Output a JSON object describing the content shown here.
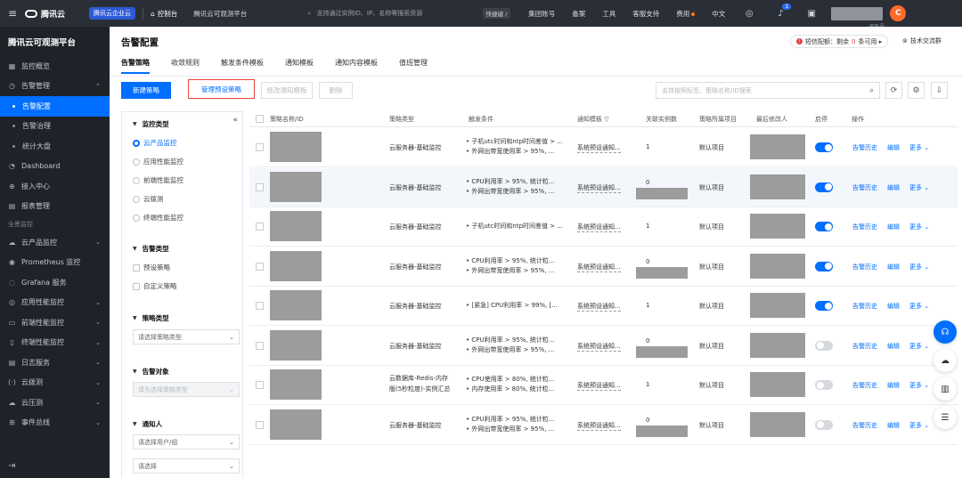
{
  "topbar": {
    "brand": "腾讯云",
    "badge": "腾讯云企业云",
    "console": "控制台",
    "platform_name": "腾讯云可观测平台",
    "search_placeholder": "支持通过实例ID、IP、名称等搜索资源",
    "shortcut": "快捷键 /",
    "links": [
      "集团账号",
      "备案",
      "工具",
      "客服支持",
      "费用",
      "中文"
    ],
    "notification_count": "1",
    "user_sub": "子账号",
    "avatar_letter": "C"
  },
  "sidebar": {
    "title": "腾讯云可观测平台",
    "items": [
      {
        "label": "监控概览",
        "icon": "dashboard-icon",
        "type": "top"
      },
      {
        "label": "告警管理",
        "icon": "alarm-icon",
        "type": "top",
        "chevron": "⌃"
      },
      {
        "label": "告警配置",
        "type": "sub",
        "active": true
      },
      {
        "label": "告警治理",
        "type": "sub"
      },
      {
        "label": "统计大盘",
        "type": "sub"
      },
      {
        "label": "Dashboard",
        "icon": "clock-icon",
        "type": "top"
      },
      {
        "label": "接入中心",
        "icon": "plug-icon",
        "type": "top"
      },
      {
        "label": "报表管理",
        "icon": "report-icon",
        "type": "top"
      }
    ],
    "group_label": "全景监控",
    "items2": [
      {
        "label": "云产品监控",
        "icon": "cloud-icon",
        "chevron": "⌄"
      },
      {
        "label": "Prometheus 监控",
        "icon": "prometheus-icon"
      },
      {
        "label": "Grafana 服务",
        "icon": "grafana-icon"
      },
      {
        "label": "应用性能监控",
        "icon": "apm-icon",
        "chevron": "⌄"
      },
      {
        "label": "前端性能监控",
        "icon": "frontend-icon",
        "chevron": "⌄"
      },
      {
        "label": "终端性能监控",
        "icon": "terminal-icon",
        "chevron": "⌄"
      },
      {
        "label": "日志服务",
        "icon": "log-icon",
        "chevron": "⌄"
      },
      {
        "label": "云拨测",
        "icon": "probe-icon",
        "chevron": "⌄"
      },
      {
        "label": "云压测",
        "icon": "stress-icon",
        "chevron": "⌄"
      },
      {
        "label": "事件总线",
        "icon": "event-icon",
        "chevron": "⌄"
      }
    ]
  },
  "header": {
    "title": "告警配置",
    "quota_label": "短信配额：剩余",
    "quota_num": "0",
    "quota_suffix": "条可用 ▸",
    "support": "技术交流群",
    "tabs": [
      "告警策略",
      "收敛规则",
      "触发条件模板",
      "通知模板",
      "通知内容模板",
      "值班管理"
    ]
  },
  "toolbar": {
    "new_policy": "新建策略",
    "manage_preset": "管理预设策略",
    "modify_template": "修改通知模板",
    "delete": "删除",
    "search_placeholder": "支持按照标签、策略名称/ID搜索"
  },
  "filter": {
    "sec_monitor_type": "监控类型",
    "monitor_types": [
      "云产品监控",
      "应用性能监控",
      "前端性能监控",
      "云拨测",
      "终端性能监控"
    ],
    "sec_alarm_type": "告警类型",
    "alarm_types": [
      "预设策略",
      "自定义策略"
    ],
    "sec_policy_type": "策略类型",
    "policy_type_placeholder": "请选择策略类型",
    "sec_alarm_object": "告警对象",
    "alarm_object_placeholder": "请先选择策略类型",
    "sec_notify": "通知人",
    "notify_placeholder": "请选择用户/组",
    "notify_placeholder2": "请选择"
  },
  "table": {
    "headers": [
      "策略名称/ID",
      "策略类型",
      "触发条件",
      "通知模板",
      "关联实例数",
      "策略所属项目",
      "最后修改人",
      "启停",
      "操作"
    ],
    "rows": [
      {
        "type": "云服务器-基础监控",
        "cond": [
          "• 子机utc时间和ntp时间差值 > ...",
          "• 外网出带宽使用率 > 95%, ..."
        ],
        "tmpl": "系统预设通知...",
        "count": "1",
        "project": "默认项目",
        "on": true
      },
      {
        "type": "云服务器-基础监控",
        "cond": [
          "• CPU利用率 > 95%, 统计粒...",
          "• 外网出带宽使用率 > 95%, ..."
        ],
        "tmpl": "系统预设通知...",
        "count": "0",
        "project": "默认项目",
        "on": true
      },
      {
        "type": "云服务器-基础监控",
        "cond": [
          "• 子机utc时间和ntp时间差值 > ..."
        ],
        "tmpl": "系统预设通知...",
        "count": "1",
        "project": "默认项目",
        "on": true
      },
      {
        "type": "云服务器-基础监控",
        "cond": [
          "• CPU利用率 > 95%, 统计粒...",
          "• 外网出带宽使用率 > 95%, ..."
        ],
        "tmpl": "系统预设通知...",
        "count": "0",
        "project": "默认项目",
        "on": true
      },
      {
        "type": "云服务器-基础监控",
        "cond": [
          "• [紧急] CPU利用率 > 99%, [..."
        ],
        "tmpl": "系统预设通知...",
        "count": "1",
        "project": "默认项目",
        "on": true
      },
      {
        "type": "云服务器-基础监控",
        "cond": [
          "• CPU利用率 > 95%, 统计粒...",
          "• 外网出带宽使用率 > 95%, ..."
        ],
        "tmpl": "系统预设通知...",
        "count": "0",
        "project": "默认项目",
        "on": false
      },
      {
        "type": "云数据库-Redis-内存",
        "type2": "版(5秒粒度)-实例汇总",
        "cond": [
          "• CPU使用率 > 80%, 统计粒...",
          "• 内存使用率 > 80%, 统计粒..."
        ],
        "tmpl": "系统预设通知...",
        "count": "1",
        "project": "默认项目",
        "on": false
      },
      {
        "type": "云服务器-基础监控",
        "cond": [
          "• CPU利用率 > 95%, 统计粒...",
          "• 外网出带宽使用率 > 95%, ..."
        ],
        "tmpl": "系统预设通知...",
        "count": "0",
        "project": "默认项目",
        "on": false
      }
    ],
    "op_history": "告警历史",
    "op_edit": "编辑",
    "op_more": "更多 ⌄"
  },
  "colors": {
    "accent": "#006eff",
    "sidebar_bg": "#1f2229",
    "topbar_bg": "#2a2e36",
    "highlight_border": "#e5483c"
  }
}
